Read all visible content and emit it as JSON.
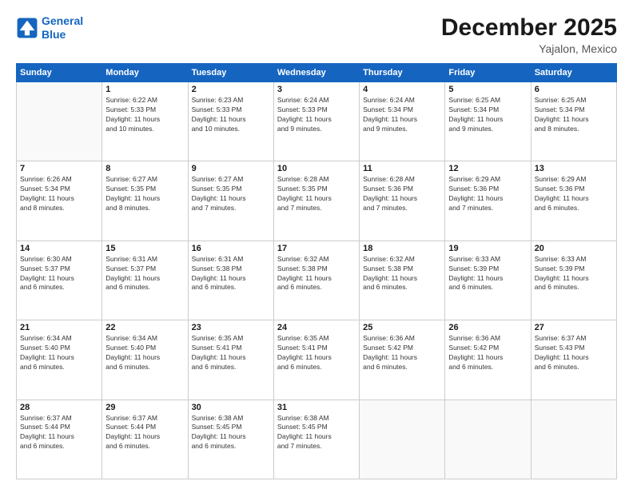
{
  "logo": {
    "line1": "General",
    "line2": "Blue"
  },
  "header": {
    "month": "December 2025",
    "location": "Yajalon, Mexico"
  },
  "weekdays": [
    "Sunday",
    "Monday",
    "Tuesday",
    "Wednesday",
    "Thursday",
    "Friday",
    "Saturday"
  ],
  "weeks": [
    [
      {
        "day": "",
        "info": ""
      },
      {
        "day": "1",
        "info": "Sunrise: 6:22 AM\nSunset: 5:33 PM\nDaylight: 11 hours\nand 10 minutes."
      },
      {
        "day": "2",
        "info": "Sunrise: 6:23 AM\nSunset: 5:33 PM\nDaylight: 11 hours\nand 10 minutes."
      },
      {
        "day": "3",
        "info": "Sunrise: 6:24 AM\nSunset: 5:33 PM\nDaylight: 11 hours\nand 9 minutes."
      },
      {
        "day": "4",
        "info": "Sunrise: 6:24 AM\nSunset: 5:34 PM\nDaylight: 11 hours\nand 9 minutes."
      },
      {
        "day": "5",
        "info": "Sunrise: 6:25 AM\nSunset: 5:34 PM\nDaylight: 11 hours\nand 9 minutes."
      },
      {
        "day": "6",
        "info": "Sunrise: 6:25 AM\nSunset: 5:34 PM\nDaylight: 11 hours\nand 8 minutes."
      }
    ],
    [
      {
        "day": "7",
        "info": "Sunrise: 6:26 AM\nSunset: 5:34 PM\nDaylight: 11 hours\nand 8 minutes."
      },
      {
        "day": "8",
        "info": "Sunrise: 6:27 AM\nSunset: 5:35 PM\nDaylight: 11 hours\nand 8 minutes."
      },
      {
        "day": "9",
        "info": "Sunrise: 6:27 AM\nSunset: 5:35 PM\nDaylight: 11 hours\nand 7 minutes."
      },
      {
        "day": "10",
        "info": "Sunrise: 6:28 AM\nSunset: 5:35 PM\nDaylight: 11 hours\nand 7 minutes."
      },
      {
        "day": "11",
        "info": "Sunrise: 6:28 AM\nSunset: 5:36 PM\nDaylight: 11 hours\nand 7 minutes."
      },
      {
        "day": "12",
        "info": "Sunrise: 6:29 AM\nSunset: 5:36 PM\nDaylight: 11 hours\nand 7 minutes."
      },
      {
        "day": "13",
        "info": "Sunrise: 6:29 AM\nSunset: 5:36 PM\nDaylight: 11 hours\nand 6 minutes."
      }
    ],
    [
      {
        "day": "14",
        "info": "Sunrise: 6:30 AM\nSunset: 5:37 PM\nDaylight: 11 hours\nand 6 minutes."
      },
      {
        "day": "15",
        "info": "Sunrise: 6:31 AM\nSunset: 5:37 PM\nDaylight: 11 hours\nand 6 minutes."
      },
      {
        "day": "16",
        "info": "Sunrise: 6:31 AM\nSunset: 5:38 PM\nDaylight: 11 hours\nand 6 minutes."
      },
      {
        "day": "17",
        "info": "Sunrise: 6:32 AM\nSunset: 5:38 PM\nDaylight: 11 hours\nand 6 minutes."
      },
      {
        "day": "18",
        "info": "Sunrise: 6:32 AM\nSunset: 5:38 PM\nDaylight: 11 hours\nand 6 minutes."
      },
      {
        "day": "19",
        "info": "Sunrise: 6:33 AM\nSunset: 5:39 PM\nDaylight: 11 hours\nand 6 minutes."
      },
      {
        "day": "20",
        "info": "Sunrise: 6:33 AM\nSunset: 5:39 PM\nDaylight: 11 hours\nand 6 minutes."
      }
    ],
    [
      {
        "day": "21",
        "info": "Sunrise: 6:34 AM\nSunset: 5:40 PM\nDaylight: 11 hours\nand 6 minutes."
      },
      {
        "day": "22",
        "info": "Sunrise: 6:34 AM\nSunset: 5:40 PM\nDaylight: 11 hours\nand 6 minutes."
      },
      {
        "day": "23",
        "info": "Sunrise: 6:35 AM\nSunset: 5:41 PM\nDaylight: 11 hours\nand 6 minutes."
      },
      {
        "day": "24",
        "info": "Sunrise: 6:35 AM\nSunset: 5:41 PM\nDaylight: 11 hours\nand 6 minutes."
      },
      {
        "day": "25",
        "info": "Sunrise: 6:36 AM\nSunset: 5:42 PM\nDaylight: 11 hours\nand 6 minutes."
      },
      {
        "day": "26",
        "info": "Sunrise: 6:36 AM\nSunset: 5:42 PM\nDaylight: 11 hours\nand 6 minutes."
      },
      {
        "day": "27",
        "info": "Sunrise: 6:37 AM\nSunset: 5:43 PM\nDaylight: 11 hours\nand 6 minutes."
      }
    ],
    [
      {
        "day": "28",
        "info": "Sunrise: 6:37 AM\nSunset: 5:44 PM\nDaylight: 11 hours\nand 6 minutes."
      },
      {
        "day": "29",
        "info": "Sunrise: 6:37 AM\nSunset: 5:44 PM\nDaylight: 11 hours\nand 6 minutes."
      },
      {
        "day": "30",
        "info": "Sunrise: 6:38 AM\nSunset: 5:45 PM\nDaylight: 11 hours\nand 6 minutes."
      },
      {
        "day": "31",
        "info": "Sunrise: 6:38 AM\nSunset: 5:45 PM\nDaylight: 11 hours\nand 7 minutes."
      },
      {
        "day": "",
        "info": ""
      },
      {
        "day": "",
        "info": ""
      },
      {
        "day": "",
        "info": ""
      }
    ]
  ]
}
